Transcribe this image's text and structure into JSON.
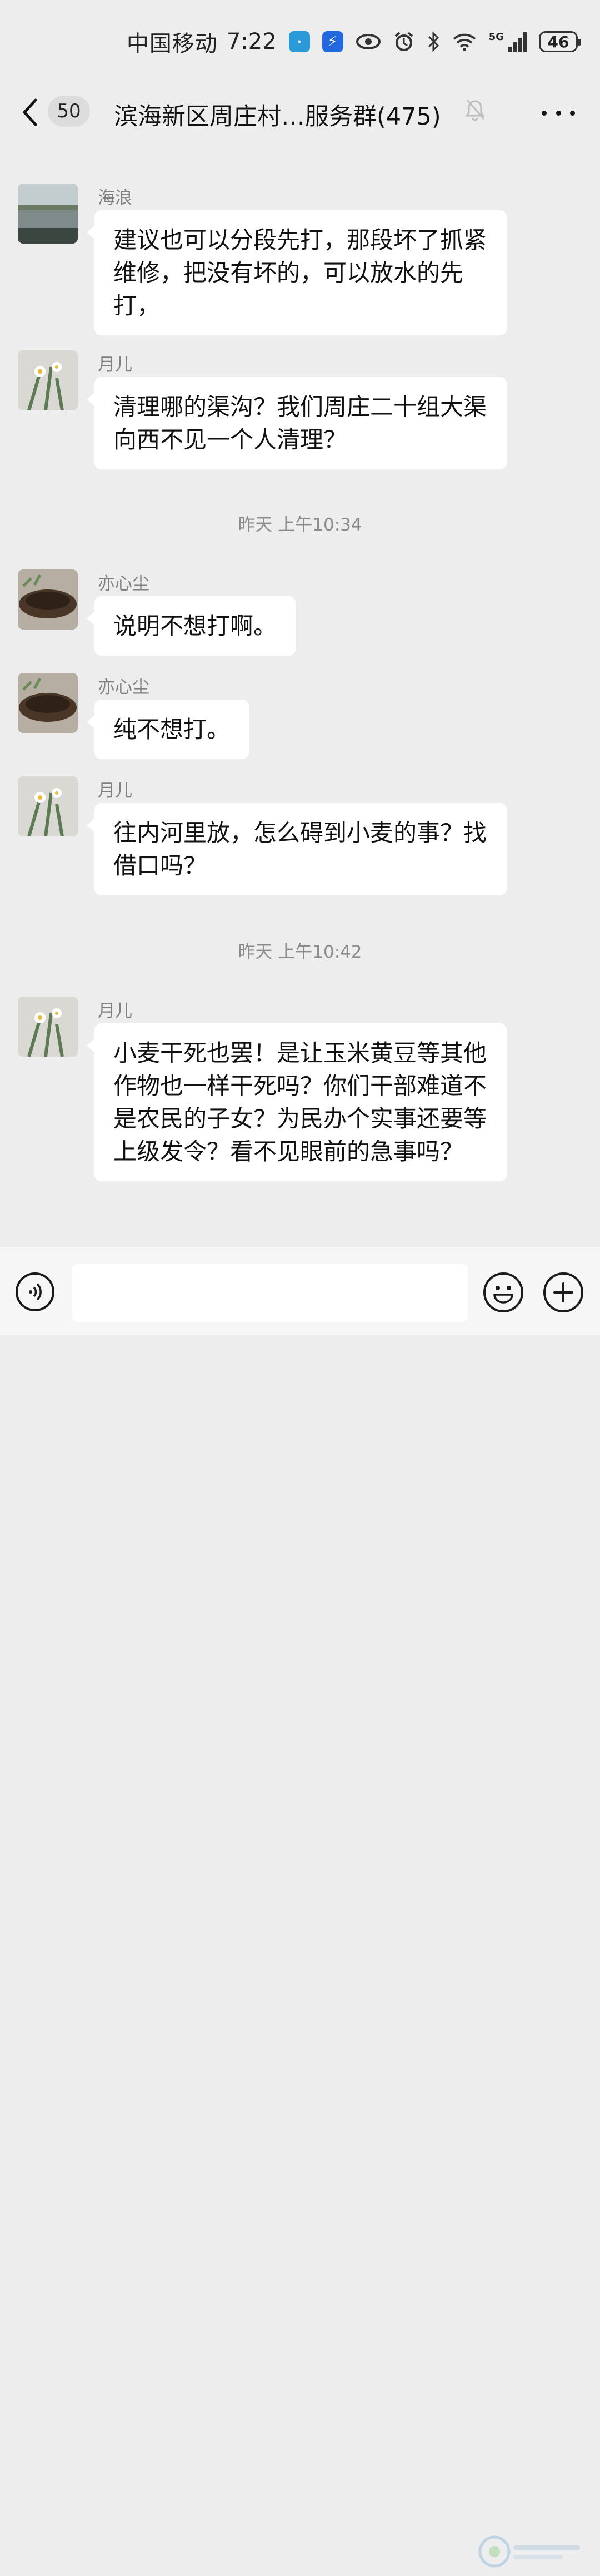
{
  "status_bar": {
    "carrier": "中国移动",
    "time": "7:22",
    "app_icons": [
      "tplink-icon",
      "thunder-icon"
    ],
    "network": "5G",
    "battery": "46"
  },
  "header": {
    "unread_count": "50",
    "title": "滨海新区周庄村…服务群(475)",
    "muted": true
  },
  "messages": [
    {
      "sender": "海浪",
      "avatar": "lake-avatar",
      "text": "建议也可以分段先打，那段坏了抓紧维修，把没有坏的，可以放水的先打，"
    },
    {
      "sender": "月儿",
      "avatar": "narcissus-avatar",
      "text": "清理哪的渠沟？我们周庄二十组大渠向西不见一个人清理？"
    },
    {
      "time_divider": "昨天 上午10:34"
    },
    {
      "sender": "亦心尘",
      "avatar": "flowerpot-avatar",
      "text": "说明不想打啊。"
    },
    {
      "sender": "亦心尘",
      "avatar": "flowerpot-avatar",
      "text": "纯不想打。"
    },
    {
      "sender": "月儿",
      "avatar": "narcissus-avatar",
      "text": "往内河里放，怎么碍到小麦的事？找借口吗？"
    },
    {
      "time_divider": "昨天 上午10:42"
    },
    {
      "sender": "月儿",
      "avatar": "narcissus-avatar",
      "text": "小麦干死也罢！是让玉米黄豆等其他作物也一样干死吗？你们干部难道不是农民的子女？为民办个实事还要等上级发令？看不见眼前的急事吗？"
    }
  ],
  "input_bar": {
    "input_value": "",
    "buttons": [
      "voice-button",
      "emoji-button",
      "more-functions-button"
    ]
  }
}
